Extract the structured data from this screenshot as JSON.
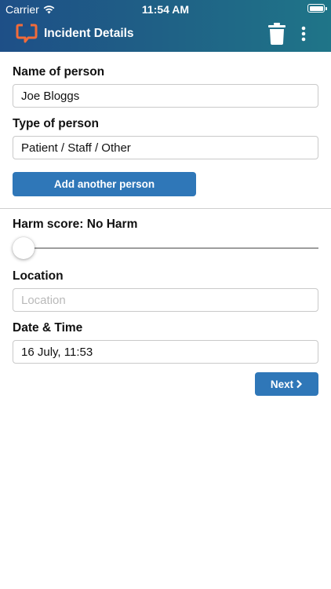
{
  "status_bar": {
    "carrier": "Carrier",
    "time": "11:54 AM"
  },
  "header": {
    "title": "Incident Details",
    "logo_icon": "speech-bubble-logo-icon",
    "delete_icon": "trash-icon",
    "menu_icon": "more-vertical-icon"
  },
  "form": {
    "name_label": "Name of person",
    "name_value": "Joe Bloggs",
    "type_label": "Type of person",
    "type_value": "Patient / Staff / Other",
    "add_person_label": "Add another person",
    "harm_label": "Harm score: No Harm",
    "harm_level": 0,
    "location_label": "Location",
    "location_placeholder": "Location",
    "date_label": "Date & Time",
    "date_value": "16 July, 11:53",
    "next_label": "Next"
  },
  "colors": {
    "accent": "#2f77b8",
    "brand_orange": "#f26b3a",
    "header_start": "#1e4f87",
    "header_end": "#1f7588"
  }
}
